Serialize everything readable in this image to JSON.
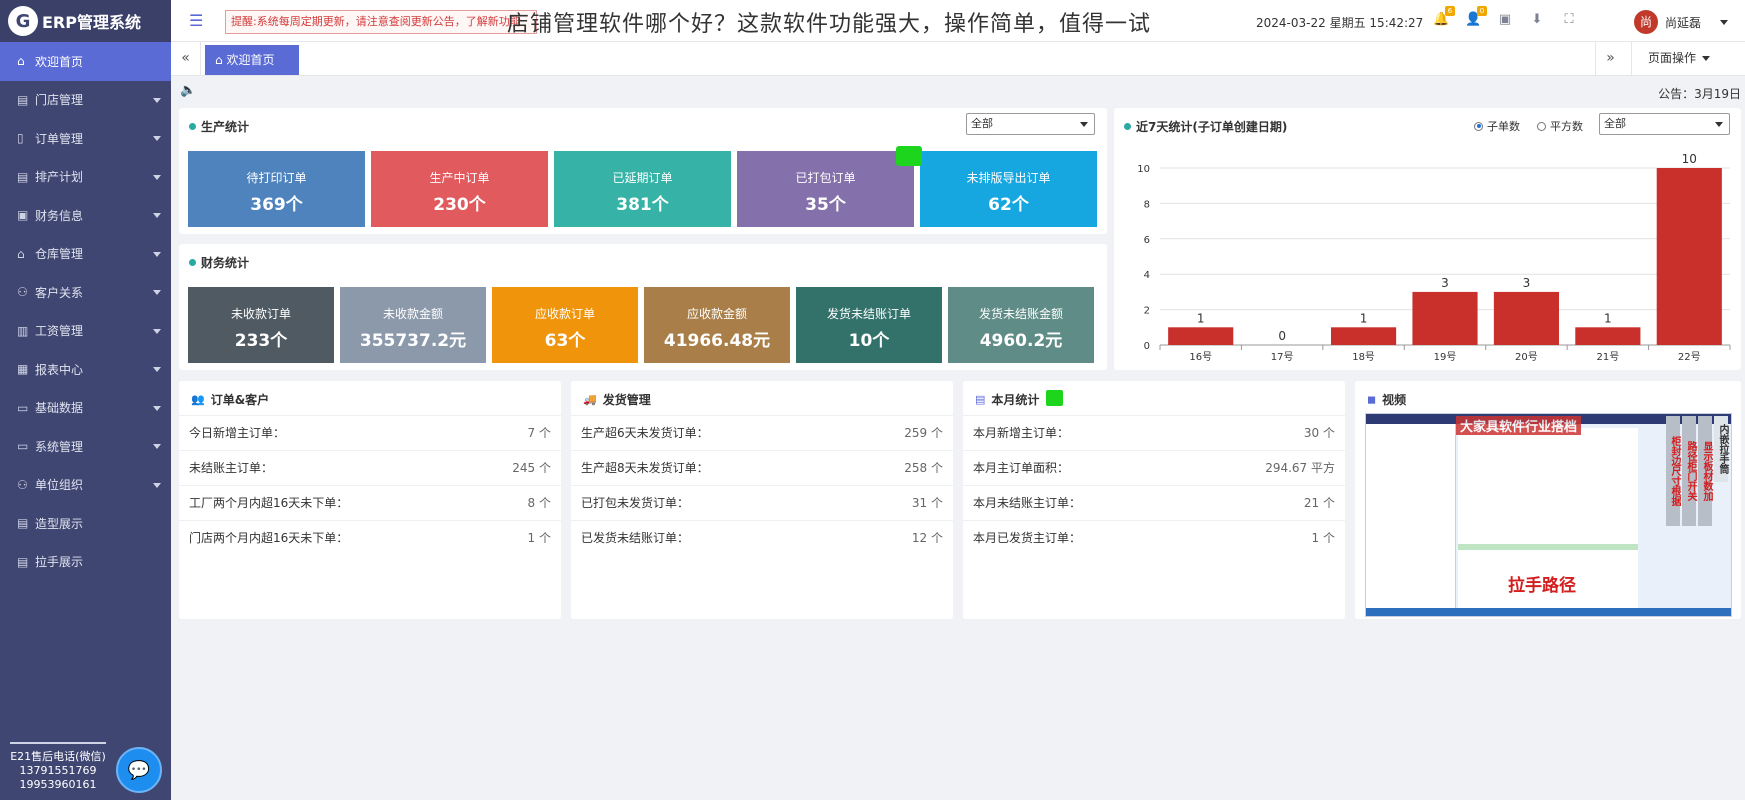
{
  "app": {
    "logo_mark": "G",
    "logo_text": "ERP管理系统"
  },
  "sidebar": {
    "items": [
      {
        "label": "欢迎首页",
        "icon": "home-icon",
        "active": true,
        "has_caret": false
      },
      {
        "label": "门店管理",
        "icon": "store-icon",
        "has_caret": true
      },
      {
        "label": "订单管理",
        "icon": "order-icon",
        "has_caret": true
      },
      {
        "label": "排产计划",
        "icon": "plan-icon",
        "has_caret": true
      },
      {
        "label": "财务信息",
        "icon": "finance-icon",
        "has_caret": true
      },
      {
        "label": "仓库管理",
        "icon": "warehouse-icon",
        "has_caret": true
      },
      {
        "label": "客户关系",
        "icon": "customer-icon",
        "has_caret": true
      },
      {
        "label": "工资管理",
        "icon": "salary-icon",
        "has_caret": true
      },
      {
        "label": "报表中心",
        "icon": "report-icon",
        "has_caret": true
      },
      {
        "label": "基础数据",
        "icon": "data-icon",
        "has_caret": true
      },
      {
        "label": "系统管理",
        "icon": "system-icon",
        "has_caret": true
      },
      {
        "label": "单位组织",
        "icon": "org-icon",
        "has_caret": true
      },
      {
        "label": "造型展示",
        "icon": "shape-icon",
        "has_caret": false
      },
      {
        "label": "拉手展示",
        "icon": "handle-icon",
        "has_caret": false
      }
    ],
    "footer": {
      "line1": "E21售后电话(微信)",
      "line2": "13791551769",
      "line3": "19953960161"
    }
  },
  "topbar": {
    "notice": "提醒:系统每周定期更新，请注意查阅更新公告，了解新功能",
    "overlay_title": "店铺管理软件哪个好？这款软件功能强大，操作简单，值得一试",
    "date": "2024-03-22",
    "weekday": "星期五",
    "time": "15:42:27",
    "badge_bell": "6",
    "badge_user": "0",
    "user_name": "尚延磊"
  },
  "tabs": {
    "home_label": "欢迎首页",
    "page_ops": "页面操作"
  },
  "announcement": "公告：3月19日",
  "production": {
    "title": "生产统计",
    "select_value": "全部",
    "tiles": [
      {
        "label": "待打印订单",
        "value": "369个",
        "color": "#4f83bd"
      },
      {
        "label": "生产中订单",
        "value": "230个",
        "color": "#e05a5e"
      },
      {
        "label": "已延期订单",
        "value": "381个",
        "color": "#36b3a6"
      },
      {
        "label": "已打包订单",
        "value": "35个",
        "color": "#8470aa"
      },
      {
        "label": "未排版导出订单",
        "value": "62个",
        "color": "#17a7e0"
      }
    ]
  },
  "finance": {
    "title": "财务统计",
    "tiles": [
      {
        "label": "未收款订单",
        "value": "233个",
        "color": "#4f5a63"
      },
      {
        "label": "未收款金额",
        "value": "355737.2元",
        "color": "#8c99ab"
      },
      {
        "label": "应收款订单",
        "value": "63个",
        "color": "#f0950b"
      },
      {
        "label": "应收款金额",
        "value": "41966.48元",
        "color": "#a97e48"
      },
      {
        "label": "发货未结账订单",
        "value": "10个",
        "color": "#33726b"
      },
      {
        "label": "发货未结账金额",
        "value": "4960.2元",
        "color": "#5f8c86"
      }
    ]
  },
  "chart_panel": {
    "title": "近7天统计(子订单创建日期)",
    "radio_1": "子单数",
    "radio_2": "平方数",
    "select_value": "全部"
  },
  "chart_data": {
    "type": "bar",
    "categories": [
      "16号",
      "17号",
      "18号",
      "19号",
      "20号",
      "21号",
      "22号"
    ],
    "values": [
      1,
      0,
      1,
      3,
      3,
      1,
      10
    ],
    "ylim": [
      0,
      10
    ],
    "yticks": [
      0,
      2,
      4,
      6,
      8,
      10
    ],
    "bar_color": "#c9302c",
    "grid": true,
    "title": "",
    "xlabel": "",
    "ylabel": ""
  },
  "orders_customers": {
    "title": "订单&客户",
    "rows": [
      {
        "k": "今日新增主订单：",
        "v": "7 个"
      },
      {
        "k": "未结账主订单：",
        "v": "245 个"
      },
      {
        "k": "工厂两个月内超16天未下单：",
        "v": "8 个"
      },
      {
        "k": "门店两个月内超16天未下单：",
        "v": "1 个"
      }
    ]
  },
  "shipping": {
    "title": "发货管理",
    "rows": [
      {
        "k": "生产超6天未发货订单：",
        "v": "259 个"
      },
      {
        "k": "生产超8天未发货订单：",
        "v": "258 个"
      },
      {
        "k": "已打包未发货订单：",
        "v": "31 个"
      },
      {
        "k": "已发货未结账订单：",
        "v": "12 个"
      }
    ]
  },
  "monthly": {
    "title": "本月统计",
    "rows": [
      {
        "k": "本月新增主订单：",
        "v": "30 个"
      },
      {
        "k": "本月主订单面积：",
        "v": "294.67 平方"
      },
      {
        "k": "本月未结账主订单：",
        "v": "21 个"
      },
      {
        "k": "本月已发货主订单：",
        "v": "1 个"
      }
    ]
  },
  "video": {
    "title": "视频",
    "thumb_title": "大家具软件行业搭档",
    "thumb_caption": "拉手路径",
    "thumb_cols": [
      "柜封边尺寸根据",
      "路径柜门开关",
      "显示板材数加",
      "内嵌拉手筒"
    ]
  }
}
